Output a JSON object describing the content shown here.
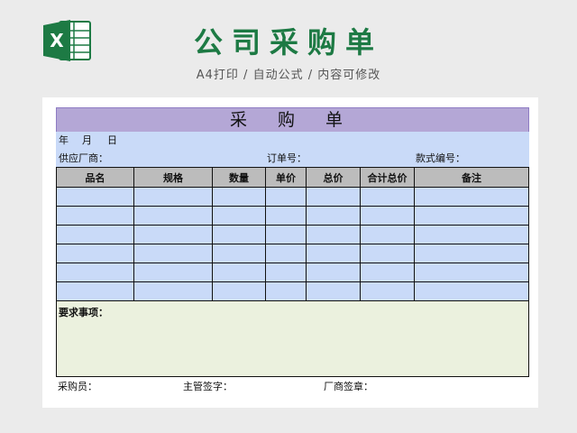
{
  "header": {
    "title": "公司采购单",
    "subtitle": "A4打印 / 自动公式 / 内容可修改",
    "logo_icon": "excel-icon",
    "logo_letter": "X"
  },
  "form": {
    "title": "采 购 单",
    "date": {
      "year": "年",
      "month": "月",
      "day": "日"
    },
    "vendor_label": "供应厂商：",
    "order_no_label": "订单号：",
    "style_no_label": "款式编号：",
    "columns": [
      "品名",
      "规格",
      "数量",
      "单价",
      "总价",
      "合计总价",
      "备注"
    ],
    "rows": [
      [
        "",
        "",
        "",
        "",
        "",
        "",
        ""
      ],
      [
        "",
        "",
        "",
        "",
        "",
        "",
        ""
      ],
      [
        "",
        "",
        "",
        "",
        "",
        "",
        ""
      ],
      [
        "",
        "",
        "",
        "",
        "",
        "",
        ""
      ],
      [
        "",
        "",
        "",
        "",
        "",
        "",
        ""
      ],
      [
        "",
        "",
        "",
        "",
        "",
        "",
        ""
      ]
    ],
    "notes_label": "要求事项：",
    "purchaser_label": "采购员：",
    "supervisor_label": "主管签字：",
    "vendor_sign_label": "厂商签章："
  },
  "colors": {
    "brand_green": "#1d7a44",
    "title_band": "#b4a7d6",
    "row_fill": "#c9daf8",
    "header_fill": "#bcbcbc",
    "notes_fill": "#ebf1de"
  }
}
